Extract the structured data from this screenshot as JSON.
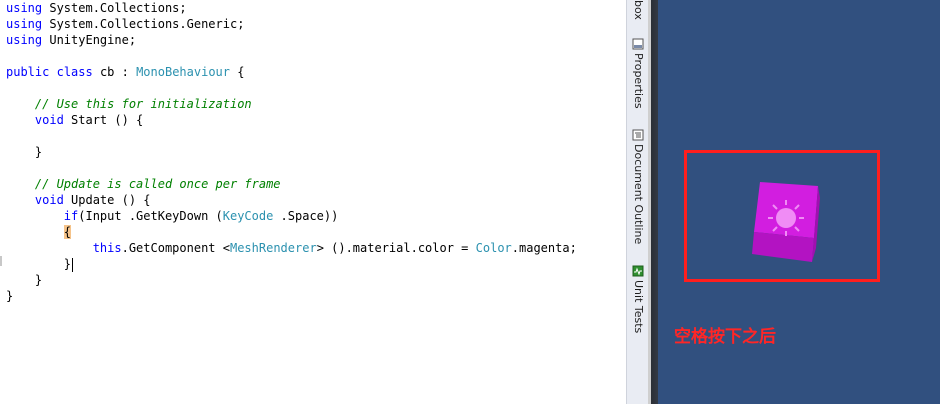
{
  "editor": {
    "lines": [
      {
        "segments": [
          {
            "t": "using",
            "c": "kw"
          },
          {
            "t": " System.Collections;",
            "c": ""
          }
        ]
      },
      {
        "segments": [
          {
            "t": "using",
            "c": "kw"
          },
          {
            "t": " System.Collections.Generic;",
            "c": ""
          }
        ]
      },
      {
        "segments": [
          {
            "t": "using",
            "c": "kw"
          },
          {
            "t": " UnityEngine;",
            "c": ""
          }
        ]
      },
      {
        "segments": []
      },
      {
        "segments": [
          {
            "t": "public",
            "c": "kw"
          },
          {
            "t": " ",
            "c": ""
          },
          {
            "t": "class",
            "c": "kw"
          },
          {
            "t": " cb : ",
            "c": ""
          },
          {
            "t": "MonoBehaviour",
            "c": "type"
          },
          {
            "t": " {",
            "c": ""
          }
        ]
      },
      {
        "segments": []
      },
      {
        "segments": [
          {
            "t": "    // Use this for initialization",
            "c": "cm"
          }
        ]
      },
      {
        "segments": [
          {
            "t": "    ",
            "c": ""
          },
          {
            "t": "void",
            "c": "kw"
          },
          {
            "t": " Start () {",
            "c": ""
          }
        ]
      },
      {
        "segments": []
      },
      {
        "segments": [
          {
            "t": "    }",
            "c": ""
          }
        ]
      },
      {
        "segments": []
      },
      {
        "segments": [
          {
            "t": "    // Update is called once per frame",
            "c": "cm"
          }
        ]
      },
      {
        "segments": [
          {
            "t": "    ",
            "c": ""
          },
          {
            "t": "void",
            "c": "kw"
          },
          {
            "t": " Update () {",
            "c": ""
          }
        ]
      },
      {
        "segments": [
          {
            "t": "        ",
            "c": ""
          },
          {
            "t": "if",
            "c": "kw"
          },
          {
            "t": "(Input .GetKeyDown (",
            "c": ""
          },
          {
            "t": "KeyCode",
            "c": "type"
          },
          {
            "t": " .Space))",
            "c": ""
          }
        ]
      },
      {
        "segments": [
          {
            "t": "        ",
            "c": ""
          },
          {
            "t": "{",
            "c": "bracehl"
          }
        ]
      },
      {
        "segments": [
          {
            "t": "            ",
            "c": ""
          },
          {
            "t": "this",
            "c": "kw"
          },
          {
            "t": ".GetComponent <",
            "c": ""
          },
          {
            "t": "MeshRenderer",
            "c": "type"
          },
          {
            "t": "> ().material.color = ",
            "c": ""
          },
          {
            "t": "Color",
            "c": "type"
          },
          {
            "t": ".magenta;",
            "c": ""
          }
        ]
      },
      {
        "segments": [
          {
            "t": "        }",
            "c": ""
          }
        ],
        "caret": true
      },
      {
        "segments": [
          {
            "t": "    }",
            "c": ""
          }
        ]
      },
      {
        "segments": [
          {
            "t": "}",
            "c": ""
          }
        ]
      }
    ]
  },
  "side_tabs": {
    "toolbox": {
      "label": "box",
      "icon": "toolbox-icon"
    },
    "properties": {
      "label": "Properties",
      "icon": "properties-icon"
    },
    "document_outline": {
      "label": "Document Outline",
      "icon": "document-outline-icon"
    },
    "unit_tests": {
      "label": "Unit Tests",
      "icon": "unit-tests-icon"
    }
  },
  "game_view": {
    "background_color": "#31507f",
    "highlight_color": "#ff1e1e",
    "cube_color": "#cc1ad6",
    "caption": "空格按下之后"
  }
}
